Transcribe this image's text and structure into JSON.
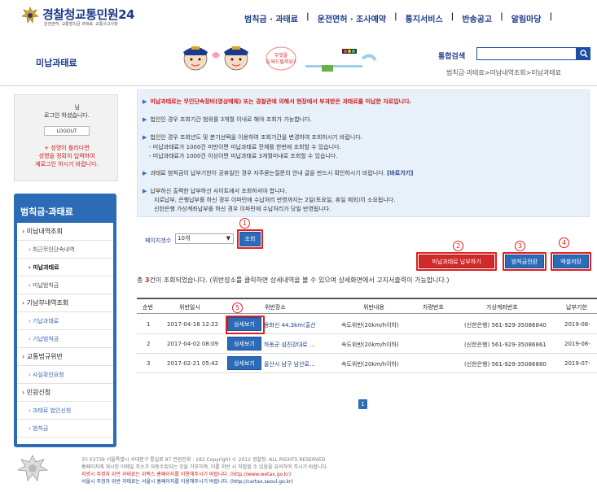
{
  "header": {
    "logo_main": "경찰청",
    "logo_accent": "교통민원24",
    "logo_sub": "운전면허, 교통범칙금 과태료, 교통사고사항",
    "nav": [
      "범칙금 · 과태료",
      "운전면허 · 조사예약",
      "통지서비스",
      "반송공고",
      "알림마당"
    ]
  },
  "subheader": {
    "page_title": "미납과태료",
    "mascot_speech": "무엇을 도와드릴까요?",
    "search_label": "통합검색",
    "search_value": "",
    "breadcrumb": "범칙금·과태료>미납내역조회>미납과태료"
  },
  "login": {
    "name_line1": "님",
    "name_line2": "로그인 하셨습니다.",
    "logout_label": "LOGOUT",
    "note_lines": [
      "+ 성명이 틀리다면",
      "성명을 정확히 입력하여",
      "재로그인 하시기 바랍니다."
    ]
  },
  "side_menu": {
    "title": "범칙금·과태료",
    "items": [
      {
        "label": "› 미납내역조회",
        "kind": "cat"
      },
      {
        "label": "› 최근무인단속내역",
        "kind": "sub"
      },
      {
        "label": "› 미납과태료",
        "kind": "on"
      },
      {
        "label": "› 미납범칙금",
        "kind": "sub"
      },
      {
        "label": "› 기납부내역조회",
        "kind": "cat"
      },
      {
        "label": "› 기납과태료",
        "kind": "subblue"
      },
      {
        "label": "› 기납범칙금",
        "kind": "subblue"
      },
      {
        "label": "› 교통법규위반",
        "kind": "cat"
      },
      {
        "label": "› 사실확인요청",
        "kind": "subblue"
      },
      {
        "label": "› 민원신청",
        "kind": "cat"
      },
      {
        "label": "› 과태료 법인신청",
        "kind": "subblue"
      },
      {
        "label": "› 범칙금",
        "kind": "subblue"
      }
    ]
  },
  "info": {
    "line1": "미납과태료는 무인단속장비(영상매체) 또는 경찰관에 의해서 현장에서 부과받은 과태료를 미납한 자료입니다.",
    "line2": "법인인 경우 조회기간 범위를 3개월 이내로 해야 조회가 가능합니다.",
    "line3": "법인인 경우 조회년도 및 분기선택을 이용하여 조회기간을 변경하여 조회하시기 바랍니다.",
    "line3a": "- 미납과태료가 1000건 미만이면 미납과태료 전체를 한번에 조회할 수 있습니다.",
    "line3b": "- 미납과태료가 1000건 이상이면 미납과태료 3개월미내로 조회할 수 있습니다.",
    "line4": "과태료 범칙금이 납부기한이 공휴일인 경우 자주묻는질문의 안내 글을 반드시 확인하시기 바랍니다.",
    "line4_link": "[바로가기]",
    "line5": "납부하신 출력한 납부하신 사이트에서 조회하셔야 합니다.",
    "line5a": "지로납부, 은행납부를 하신 경우 이파민에 수납처리 반영까지는 2일(토요일, 휴일 제외)이 소요됩니다.",
    "line5b": "신한은행 가상계좌납부를 하신 경우 이파민에 수납처리가 당일 반영됩니다."
  },
  "controls": {
    "pagesize_label": "페이지갯수",
    "pagesize_value": "10개",
    "query_label": "조회",
    "pay_label": "미납과태료 납부하기",
    "change_label": "범칙금전환",
    "excel_label": "엑셀저장",
    "result_prefix": "총 ",
    "result_count": "3",
    "result_suffix": "건이 조회되었습니다. (위반장소를 클릭하면 상세내역을 볼 수 있으며 상세화면에서 고지서출력이 가능합니다.)",
    "markers": [
      "1",
      "2",
      "3",
      "4",
      "5"
    ]
  },
  "table": {
    "headers": [
      "순번",
      "위반일시",
      "위반장소",
      "위반내용",
      "차량번호",
      "가상계좌번호",
      "납부기한"
    ],
    "detail_label": "상세보기",
    "rows": [
      {
        "no": "1",
        "date": "2017-04-18 12:22",
        "place": "용화신 44.3km(출산",
        "content": "속도위반(20km/h이하)",
        "car": "",
        "account": "(신한은행) 561-929-35086840",
        "due": "2019-08-"
      },
      {
        "no": "2",
        "date": "2017-04-02 08:09",
        "place": "하동군 섬진강대로 …",
        "content": "속도위반(20km/h이하)",
        "car": "",
        "account": "(신한은행) 561-929-35086861",
        "due": "2019-08-"
      },
      {
        "no": "3",
        "date": "2017-02-21 05:42",
        "place": "울산시 남구 남산로…",
        "content": "속도위반(20km/h이하)",
        "car": "",
        "account": "(신한은행) 561-929-35086880",
        "due": "2019-07-"
      }
    ]
  },
  "pager": {
    "current": "1"
  },
  "footer": {
    "line1": "우) 03739 서울특별시 서대문구 통일로 97 민원전화 : 182     Copyright © 2012 경찰청. ALL RIGHTS RESERVED",
    "line2": "홈페이지에 게시된 이메일 주소가 자동수집되는 것을 거부하며, 이를 위반 시 처벌될 수 있음을 유의하여 주시기 바랍니다.",
    "line3": "지방시 주정차 위반 과태료는 위택스 홈페이지를 이용해주시기 바랍니다. (http://www.wetax.go.kr)",
    "line4": "서울시 주정차 위반 과태료는 서울시 홈페이지를 이용해주시기 바랍니다. (http://cartax.seoul.go.kr)"
  }
}
